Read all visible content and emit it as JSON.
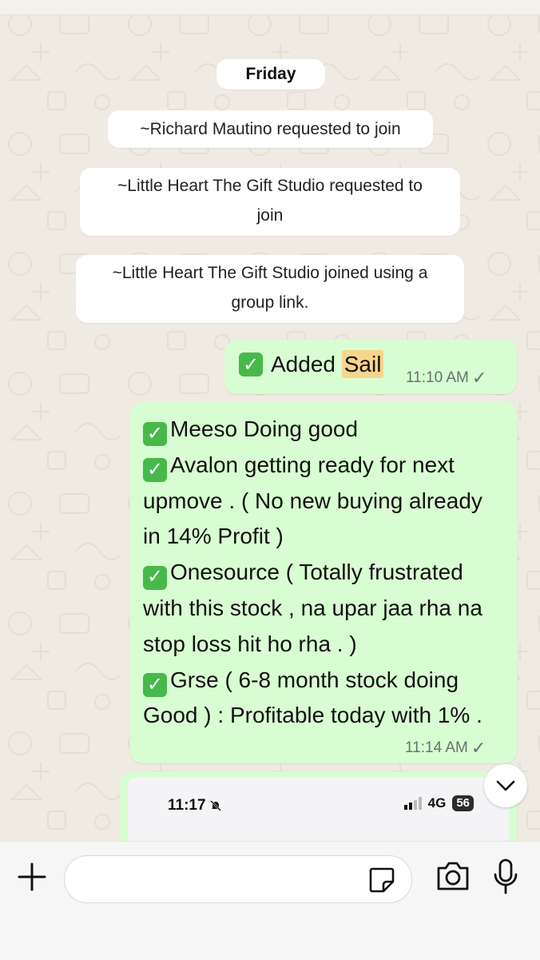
{
  "chat": {
    "date_separator": "Friday",
    "system_messages": [
      "~Richard  Mautino requested to join",
      "~Little Heart The Gift Studio requested to",
      "join",
      "~Little Heart The Gift Studio joined using a",
      "group link."
    ]
  },
  "messages": [
    {
      "text_prefix": "Added ",
      "highlight": "Sail",
      "time": "11:10 AM"
    },
    {
      "lines": [
        "Meeso Doing good",
        "Avalon getting ready for next",
        "upmove . ( No new buying already",
        "in 14% Profit )",
        "Onesource ( Totally frustrated",
        "with this stock , na upar jaa rha na",
        "stop loss hit ho rha . )",
        "Grse ( 6-8 month stock doing",
        "Good ) : Profitable today with 1% ."
      ],
      "time": "11:14 AM"
    },
    {
      "screenshot_time": "11:17",
      "network": "4G",
      "battery": "56"
    }
  ],
  "icons": {
    "check": "white-heavy-check-mark",
    "read_tick": "single-tick-icon",
    "scroll_down": "chevron-down-icon",
    "attach": "plus-icon",
    "sticker": "sticker-icon",
    "camera": "camera-icon",
    "mic": "microphone-icon"
  },
  "colors": {
    "chat_background": "#efeae2",
    "outgoing_bubble": "#d9fdd3",
    "check_green": "#47b94b",
    "highlight": "#f7d58a"
  }
}
